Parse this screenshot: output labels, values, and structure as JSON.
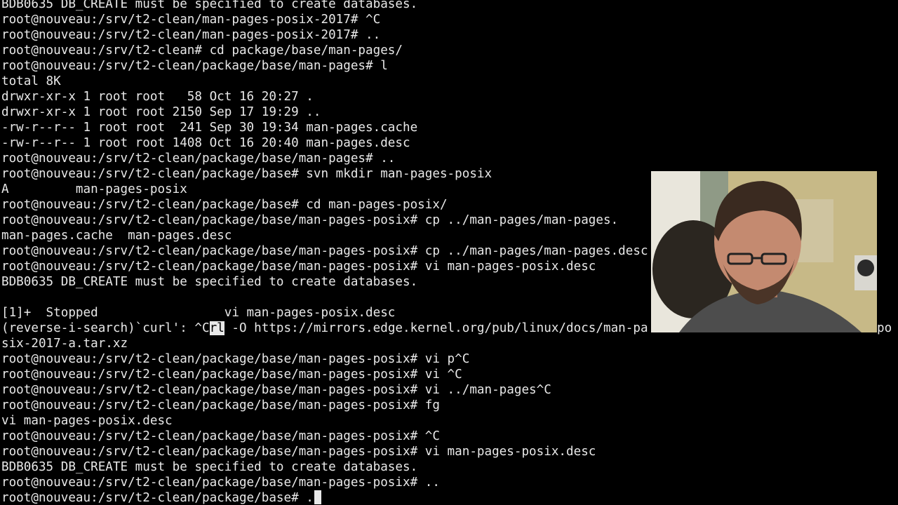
{
  "terminal": {
    "lines": [
      "BDB0635 DB_CREATE must be specified to create databases.",
      "root@nouveau:/srv/t2-clean/man-pages-posix-2017# ^C",
      "root@nouveau:/srv/t2-clean/man-pages-posix-2017# ..",
      "root@nouveau:/srv/t2-clean# cd package/base/man-pages/",
      "root@nouveau:/srv/t2-clean/package/base/man-pages# l",
      "total 8K",
      "drwxr-xr-x 1 root root   58 Oct 16 20:27 .",
      "drwxr-xr-x 1 root root 2150 Sep 17 19:29 ..",
      "-rw-r--r-- 1 root root  241 Sep 30 19:34 man-pages.cache",
      "-rw-r--r-- 1 root root 1408 Oct 16 20:40 man-pages.desc",
      "root@nouveau:/srv/t2-clean/package/base/man-pages# ..",
      "root@nouveau:/srv/t2-clean/package/base# svn mkdir man-pages-posix",
      "A         man-pages-posix",
      "root@nouveau:/srv/t2-clean/package/base# cd man-pages-posix/",
      "root@nouveau:/srv/t2-clean/package/base/man-pages-posix# cp ../man-pages/man-pages.",
      "man-pages.cache  man-pages.desc",
      "root@nouveau:/srv/t2-clean/package/base/man-pages-posix# cp ../man-pages/man-pages.desc",
      "root@nouveau:/srv/t2-clean/package/base/man-pages-posix# vi man-pages-posix.desc",
      "BDB0635 DB_CREATE must be specified to create databases.",
      "",
      "[1]+  Stopped                 vi man-pages-posix.desc",
      "",
      "six-2017-a.tar.xz",
      "root@nouveau:/srv/t2-clean/package/base/man-pages-posix# vi p^C",
      "root@nouveau:/srv/t2-clean/package/base/man-pages-posix# vi ^C",
      "root@nouveau:/srv/t2-clean/package/base/man-pages-posix# vi ../man-pages^C",
      "root@nouveau:/srv/t2-clean/package/base/man-pages-posix# fg",
      "vi man-pages-posix.desc",
      "root@nouveau:/srv/t2-clean/package/base/man-pages-posix# ^C",
      "root@nouveau:/srv/t2-clean/package/base/man-pages-posix# vi man-pages-posix.desc",
      "BDB0635 DB_CREATE must be specified to create databases.",
      "root@nouveau:/srv/t2-clean/package/base/man-pages-posix# ..",
      ""
    ],
    "search": {
      "prefix": "(reverse-i-search)`curl': ^C",
      "match": "rl",
      "rest": " -O https://mirrors.edge.kernel.org/pub/linux/docs/man-pa",
      "tail": "po"
    },
    "final_prompt": "root@nouveau:/srv/t2-clean/package/base# .",
    "colors": {
      "background": "#000000",
      "foreground": "#e8e8e8"
    }
  },
  "webcam": {
    "icon": "person-webcam-overlay"
  }
}
